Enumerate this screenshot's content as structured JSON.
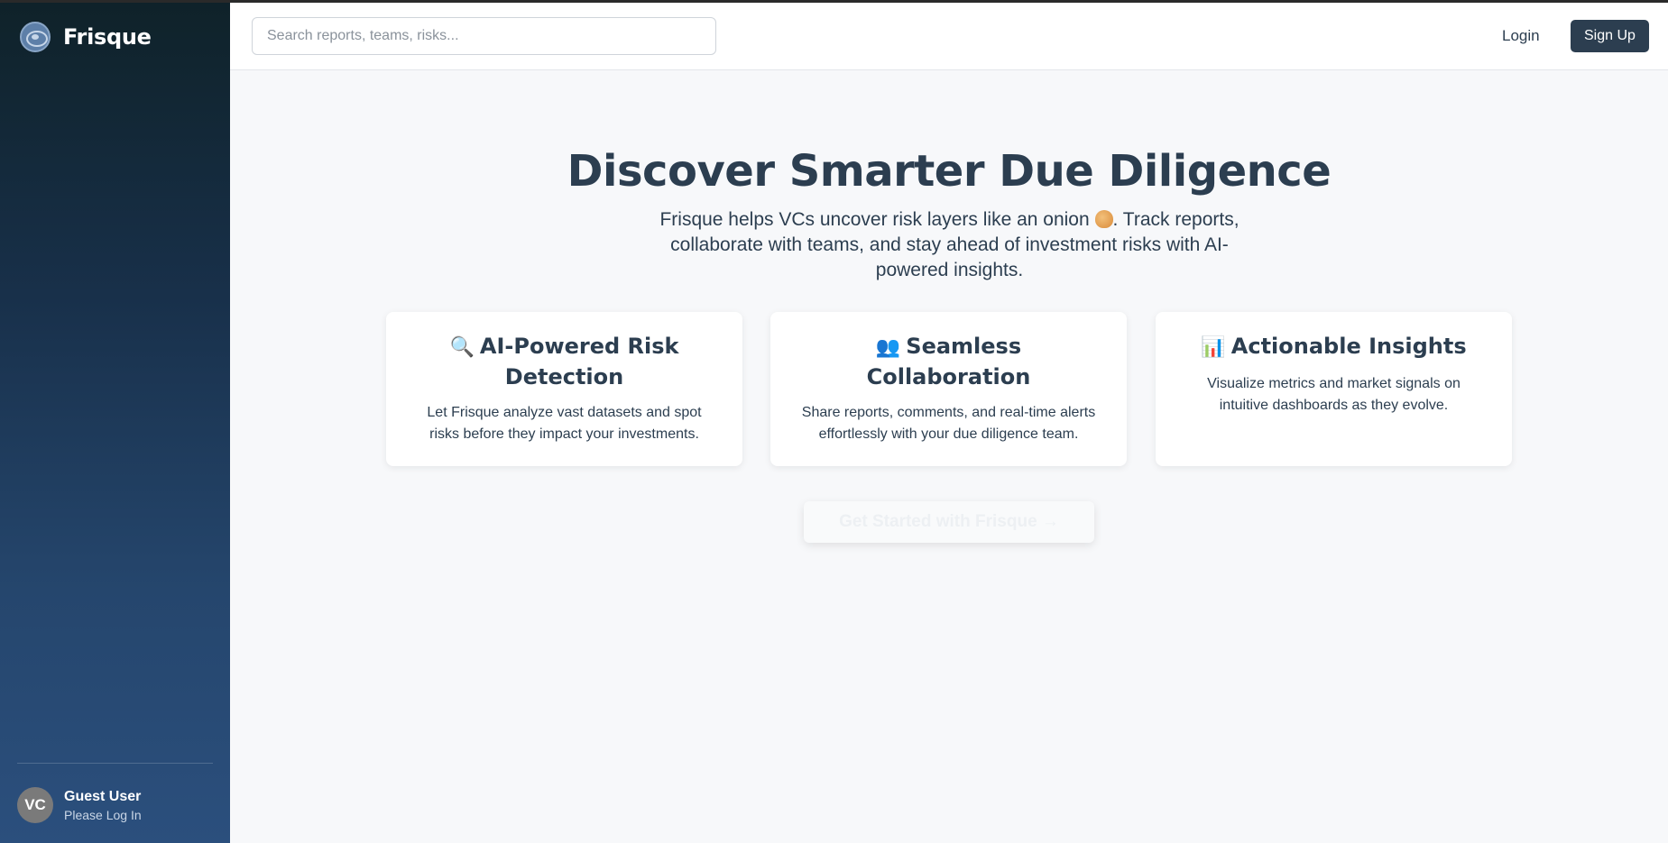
{
  "sidebar": {
    "brand": "Frisque",
    "user": {
      "initials": "VC",
      "name": "Guest User",
      "status": "Please Log In"
    }
  },
  "header": {
    "search_placeholder": "Search reports, teams, risks...",
    "login_label": "Login",
    "signup_label": "Sign Up"
  },
  "hero": {
    "title": "Discover Smarter Due Diligence",
    "subtitle_before": "Frisque helps VCs uncover risk layers like an onion ",
    "subtitle_after": ". Track reports, collaborate with teams, and stay ahead of investment risks with AI-powered insights."
  },
  "features": [
    {
      "icon": "🔍",
      "icon_name": "magnifier-icon",
      "title": "AI-Powered Risk Detection",
      "text": "Let Frisque analyze vast datasets and spot risks before they impact your investments."
    },
    {
      "icon": "👥",
      "icon_name": "people-icon",
      "title": "Seamless Collaboration",
      "text": "Share reports, comments, and real-time alerts effortlessly with your due diligence team."
    },
    {
      "icon": "📊",
      "icon_name": "bar-chart-icon",
      "title": "Actionable Insights",
      "text": "Visualize metrics and market signals on intuitive dashboards as they evolve."
    }
  ],
  "cta": {
    "label": "Get Started with Frisque →"
  }
}
